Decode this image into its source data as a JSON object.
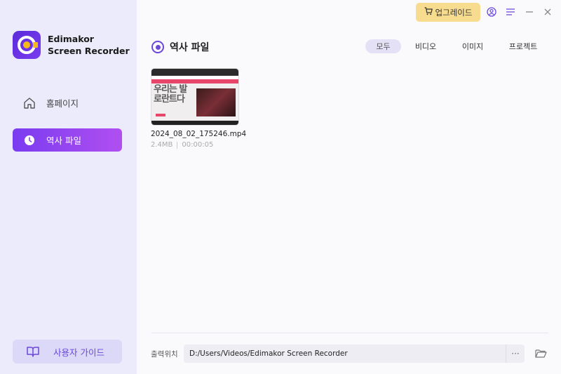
{
  "app": {
    "brand_line1": "Edimakor",
    "brand_line2": "Screen Recorder"
  },
  "sidebar": {
    "items": [
      {
        "label": "홈페이지",
        "icon": "home-icon"
      },
      {
        "label": "역사 파일",
        "icon": "clock-icon",
        "active": true
      }
    ],
    "guide_label": "사용자 가이드",
    "guide_icon": "book-icon"
  },
  "topbar": {
    "upgrade_label": "업그레이드",
    "upgrade_icon": "cart-icon",
    "icons": [
      "user-icon",
      "menu-icon",
      "minimize-icon",
      "close-icon"
    ]
  },
  "header": {
    "title": "역사 파일",
    "filters": [
      {
        "label": "모두",
        "active": true
      },
      {
        "label": "비디오"
      },
      {
        "label": "이미지"
      },
      {
        "label": "프로젝트"
      }
    ]
  },
  "files": [
    {
      "name": "2024_08_02_175246.mp4",
      "size": "2.4MB",
      "duration": "00:00:05",
      "thumb_text": "우리는 발\n로란트다"
    }
  ],
  "footer": {
    "output_label": "출력위치",
    "output_path": "D:/Users/Videos/Edimakor Screen Recorder",
    "more_label": "···"
  },
  "colors": {
    "accent": "#7a3cf0",
    "sidebar_bg": "#ecebfb",
    "upgrade_bg": "#f7dc8f"
  }
}
